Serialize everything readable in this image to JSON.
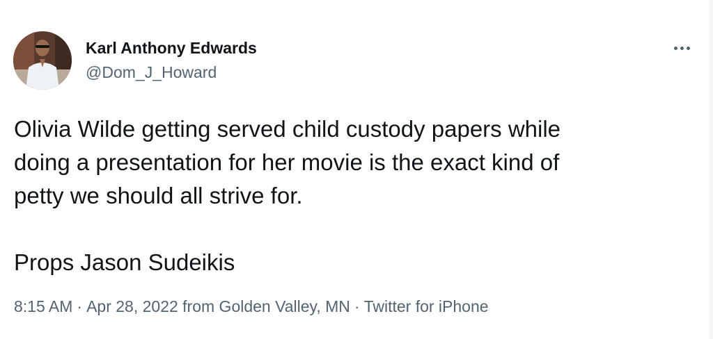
{
  "author": {
    "display_name": "Karl Anthony Edwards",
    "handle": "@Dom_J_Howard"
  },
  "tweet": {
    "lines": [
      "Olivia Wilde getting served child custody papers while",
      "doing a presentation for her movie is the exact kind of",
      "petty we should all strive for."
    ],
    "closing": "Props Jason Sudeikis"
  },
  "meta": {
    "time": "8:15 AM",
    "date": "Apr 28, 2022",
    "location": "from Golden Valley, MN",
    "source": "Twitter for iPhone",
    "separator": "·"
  },
  "icons": {
    "more": "more-horizontal-icon"
  },
  "colors": {
    "primary_text": "#0f1419",
    "secondary_text": "#536471"
  }
}
